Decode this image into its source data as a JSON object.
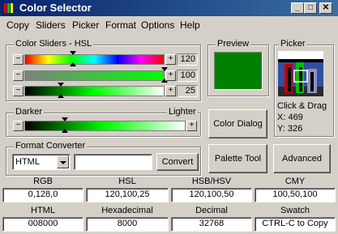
{
  "window": {
    "title": "Color Selector"
  },
  "menu": [
    {
      "label": "Copy"
    },
    {
      "label": "Sliders"
    },
    {
      "label": "Picker"
    },
    {
      "label": "Format"
    },
    {
      "label": "Options"
    },
    {
      "label": "Help"
    }
  ],
  "sliders": {
    "group_label": "Color Sliders - HSL",
    "hue": {
      "value": "120"
    },
    "saturation": {
      "value": "100"
    },
    "lightness": {
      "value": "25"
    }
  },
  "shade": {
    "group_label": "",
    "darker": "Darker",
    "lighter": "Lighter"
  },
  "preview": {
    "label": "Preview",
    "color": "#008000"
  },
  "picker": {
    "label": "Picker",
    "hint": "Click & Drag",
    "x_label": "X: 469",
    "y_label": "Y: 326"
  },
  "format": {
    "group_label": "Format Converter",
    "selected": "HTML",
    "input_value": "",
    "convert_label": "Convert"
  },
  "buttons": {
    "color_dialog": "Color Dialog",
    "palette_tool": "Palette Tool",
    "advanced": "Advanced"
  },
  "values_row1": [
    {
      "header": "RGB",
      "value": "0,128,0"
    },
    {
      "header": "HSL",
      "value": "120,100,25"
    },
    {
      "header": "HSB/HSV",
      "value": "120,100,50"
    },
    {
      "header": "CMY",
      "value": "100,50,100"
    }
  ],
  "values_row2": [
    {
      "header": "HTML",
      "value": "008000"
    },
    {
      "header": "Hexadecimal",
      "value": "8000"
    },
    {
      "header": "Decimal",
      "value": "32768"
    },
    {
      "header": "Swatch",
      "value": "CTRL-C to Copy"
    }
  ]
}
